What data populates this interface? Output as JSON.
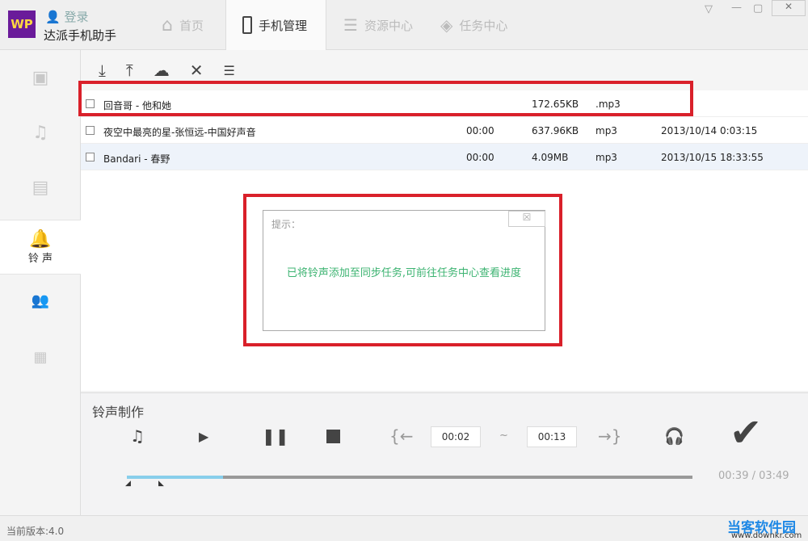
{
  "app": {
    "logo": "WP",
    "login": "登录",
    "name": "达派手机助手"
  },
  "tabs": [
    {
      "label": "首页"
    },
    {
      "label": "手机管理"
    },
    {
      "label": "资源中心"
    },
    {
      "label": "任务中心"
    }
  ],
  "sidebar": {
    "active_label": "铃 声"
  },
  "files": [
    {
      "name": "回音哥 - 他和她",
      "duration": "",
      "size": "172.65KB",
      "type": ".mp3",
      "date": ""
    },
    {
      "name": "夜空中最亮的星-张恒远-中国好声音",
      "duration": "00:00",
      "size": "637.96KB",
      "type": "mp3",
      "date": "2013/10/14 0:03:15"
    },
    {
      "name": "Bandari - 春野",
      "duration": "00:00",
      "size": "4.09MB",
      "type": "mp3",
      "date": "2013/10/15 18:33:55"
    }
  ],
  "dialog": {
    "title": "提示：",
    "message": "已将铃声添加至同步任务,可前往任务中心查看进度"
  },
  "maker": {
    "title": "铃声制作",
    "start": "00:02",
    "tilde": "~",
    "end": "00:13",
    "time": "00:39 / 03:49",
    "progress": 0.17
  },
  "status": {
    "version": "当前版本:4.0",
    "watermark": "当客软件园",
    "watermark_url": "www.downkr.com"
  }
}
